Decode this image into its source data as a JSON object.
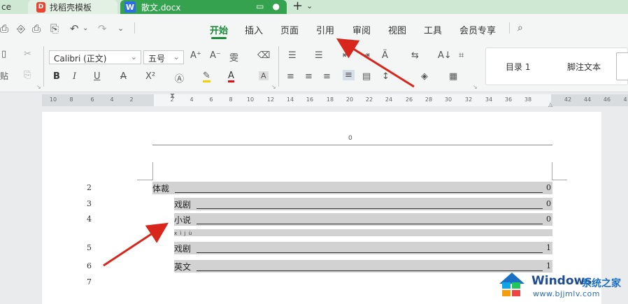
{
  "tabs": [
    {
      "label": "ce"
    },
    {
      "label": "找稻壳模板",
      "icon": "daoke-icon"
    },
    {
      "label": "散文.docx",
      "icon": "wps-writer-icon",
      "active": true
    }
  ],
  "newtab_symbol": "+",
  "newtab_dd": "⌄",
  "menu": [
    "开始",
    "插入",
    "页面",
    "引用",
    "审阅",
    "视图",
    "工具",
    "会员专享"
  ],
  "ribbon": {
    "font_name": "Calibri (正文)",
    "font_size": "五号",
    "paste_label": "贴",
    "bold": "B",
    "italic": "I",
    "underline": "U",
    "strike": "A",
    "superscript": "X²",
    "grow": "A⁺",
    "shrink": "A⁻",
    "phonetic": "雯",
    "font_color": "A",
    "char_shade": "A",
    "sort": "A↓",
    "styles": [
      "目录 1",
      "脚注文本"
    ]
  },
  "ruler_left": [
    "10",
    "8",
    "6",
    "4",
    "2"
  ],
  "ruler_right": [
    "2",
    "4",
    "6",
    "8",
    "10",
    "12",
    "14",
    "16",
    "18",
    "20",
    "22",
    "24",
    "26",
    "28",
    "30",
    "32",
    "34",
    "36",
    "38",
    "42",
    "44",
    "46",
    "4"
  ],
  "page": {
    "header_number": "0",
    "toc": [
      {
        "line": "2",
        "label": "体裁",
        "page": "0",
        "level": 1
      },
      {
        "line": "3",
        "label": "戏剧",
        "page": "0",
        "level": 2
      },
      {
        "line": "4",
        "label": "小说",
        "page": "0",
        "level": 2
      },
      {
        "line": "5",
        "label": "戏剧",
        "page": "1",
        "level": 2,
        "ruby": "x ì j ù"
      },
      {
        "line": "6",
        "label": "英文",
        "page": "1",
        "level": 2
      }
    ],
    "extra_line": "7"
  },
  "watermark": {
    "brand": "Windows",
    "cn": "系统之家",
    "url": "www.bjjmlv.com"
  },
  "colors": {
    "tab_active": "#35a24f",
    "menu_active": "#1a8a3a",
    "arrow": "#d9261c",
    "toc_highlight": "#d2d2d2"
  }
}
